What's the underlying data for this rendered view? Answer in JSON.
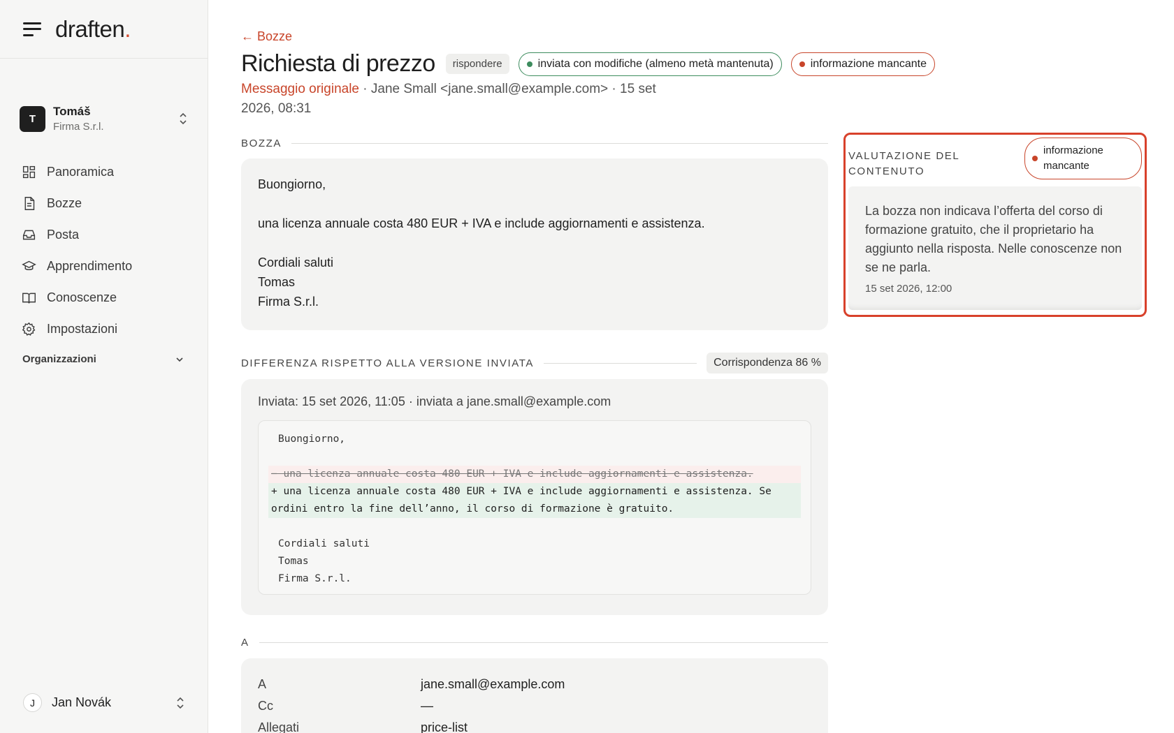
{
  "sidebar": {
    "logo": "draften",
    "logo_dot": ".",
    "account": {
      "initial": "T",
      "name": "Tomáš",
      "org": "Firma S.r.l."
    },
    "items": [
      {
        "label": "Panoramica",
        "icon": "grid-icon"
      },
      {
        "label": "Bozze",
        "icon": "document-icon"
      },
      {
        "label": "Posta",
        "icon": "inbox-icon"
      },
      {
        "label": "Apprendimento",
        "icon": "graduation-cap-icon"
      },
      {
        "label": "Conoscenze",
        "icon": "book-icon"
      },
      {
        "label": "Impostazioni",
        "icon": "gear-icon"
      }
    ],
    "orgs_label": "Organizzazioni",
    "user": {
      "initial": "J",
      "name": "Jan Novák"
    }
  },
  "header": {
    "back": "← Bozze",
    "title": "Richiesta di prezzo",
    "type_badge": "rispondere",
    "status_badge": "inviata con modifiche (almeno metà mantenuta)",
    "issue_badge": "informazione mancante",
    "meta_link": "Messaggio originale",
    "meta_rest": " · Jane Small <jane.small@example.com> · 15 set 2026, 08:31"
  },
  "draft": {
    "label": "BOZZA",
    "lines": [
      "Buongiorno,",
      "",
      "una licenza annuale costa 480 EUR + IVA e include aggiornamenti e assistenza.",
      "",
      "Cordiali saluti",
      "Tomas",
      "Firma S.r.l."
    ]
  },
  "diff": {
    "label": "DIFFERENZA RISPETTO ALLA VERSIONE INVIATA",
    "match": "Corrispondenza 86 %",
    "sent": "Inviata: 15 set 2026, 11:05 · inviata a jane.small@example.com",
    "line1": "Buongiorno,",
    "removed": "− una licenza annuale costa 480 EUR + IVA e include aggiornamenti e assistenza.",
    "added": "+ una licenza annuale costa 480 EUR + IVA e include aggiornamenti e assistenza. Se ordini entro la fine dell’anno, il corso di formazione è gratuito.",
    "closing": [
      "Cordiali saluti",
      "Tomas",
      "Firma S.r.l."
    ]
  },
  "recipients": {
    "label": "A",
    "rows": [
      {
        "k": "A",
        "v": "jane.small@example.com"
      },
      {
        "k": "Cc",
        "v": "—"
      },
      {
        "k": "Allegati",
        "v": "price-list"
      }
    ]
  },
  "evaluation": {
    "title": "VALUTAZIONE DEL CONTENUTO",
    "badge": "informazione mancante",
    "text": "La bozza non indicava l’offerta del corso di formazione gratuito, che il proprietario ha aggiunto nella risposta. Nelle conoscenze non se ne parla.",
    "date": "15 set 2026, 12:00"
  },
  "colors": {
    "accent": "#c8452a",
    "success": "#3d8c5e",
    "highlight": "#d8412b"
  }
}
